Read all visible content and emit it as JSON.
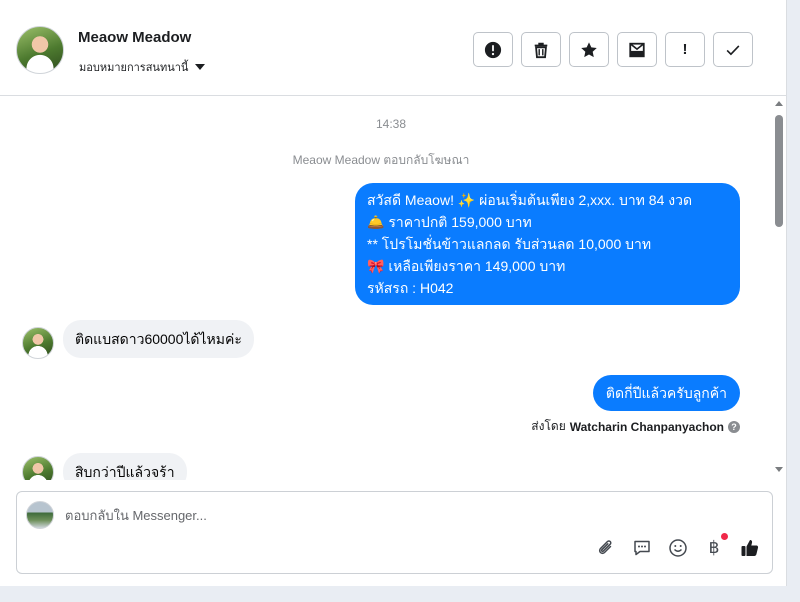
{
  "header": {
    "contact_name": "Meaow Meadow",
    "assign_label": "มอบหมายการสนทนานี้",
    "toolbar": [
      {
        "icon": "alert-circle-icon"
      },
      {
        "icon": "trash-icon"
      },
      {
        "icon": "star-icon"
      },
      {
        "icon": "mail-icon"
      },
      {
        "icon": "exclamation-icon",
        "label": "!"
      },
      {
        "icon": "checkmark-icon"
      }
    ]
  },
  "conversation": {
    "timestamp": "14:38",
    "system_message": "Meaow Meadow ตอบกลับโฆษณา",
    "ad_message": {
      "line1": "สวัสดี Meaow! ✨  ผ่อนเริ่มต้นเพียง 2,xxx. บาท 84 งวด",
      "line2": "🛎️ ราคาปกติ  159,000 บาท",
      "line3": "** โปรโมชั่นข้าวแลกลด รับส่วนลด 10,000 บาท",
      "line4": "🎀  เหลือเพียงราคา 149,000 บาท",
      "line5": " รหัสรถ : H042"
    },
    "incoming_1": "ติดแบสดาว60000ได้ไหมค่ะ",
    "outgoing_1": "ติดกี่ปีแล้วครับลูกค้า",
    "sent_by_prefix": "ส่งโดย",
    "sent_by_name": "Watcharin Chanpanyachon",
    "incoming_2": "สิบกว่าปีแล้วจร้า"
  },
  "composer": {
    "placeholder": "ตอบกลับใน Messenger...",
    "currency_symbol": "฿"
  },
  "colors": {
    "accent": "#0a7cff",
    "incoming_bubble": "#f0f2f5",
    "notification_dot": "#f02849"
  }
}
